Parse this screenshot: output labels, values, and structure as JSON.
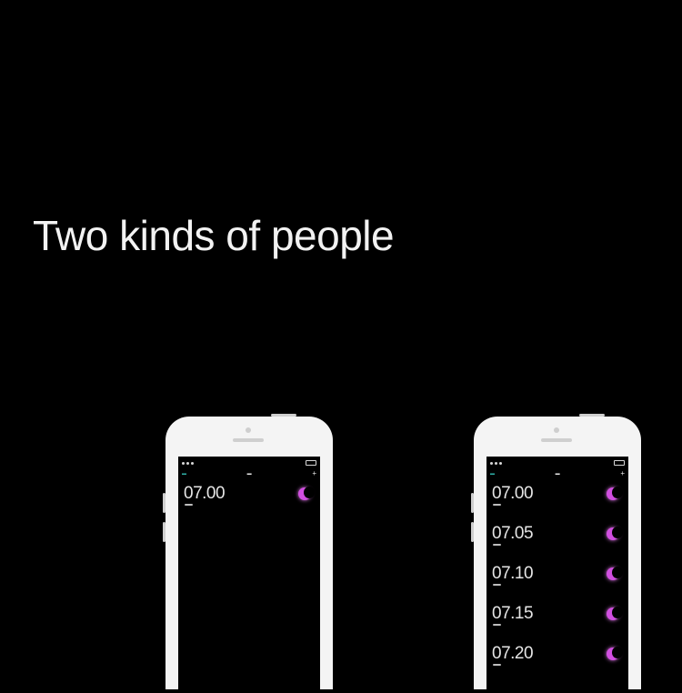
{
  "headline": "Two kinds of people",
  "colors": {
    "background": "#000000",
    "phone_body": "#f4f4f4",
    "alarm_moon": "#d14fe0",
    "nav_edit": "#2fb0a8"
  },
  "phones": [
    {
      "alarms": [
        {
          "time": "07.00",
          "icon": "moon-icon"
        }
      ]
    },
    {
      "alarms": [
        {
          "time": "07.00",
          "icon": "moon-icon"
        },
        {
          "time": "07.05",
          "icon": "moon-icon"
        },
        {
          "time": "07.10",
          "icon": "moon-icon"
        },
        {
          "time": "07.15",
          "icon": "moon-icon"
        },
        {
          "time": "07.20",
          "icon": "moon-icon"
        }
      ]
    }
  ]
}
